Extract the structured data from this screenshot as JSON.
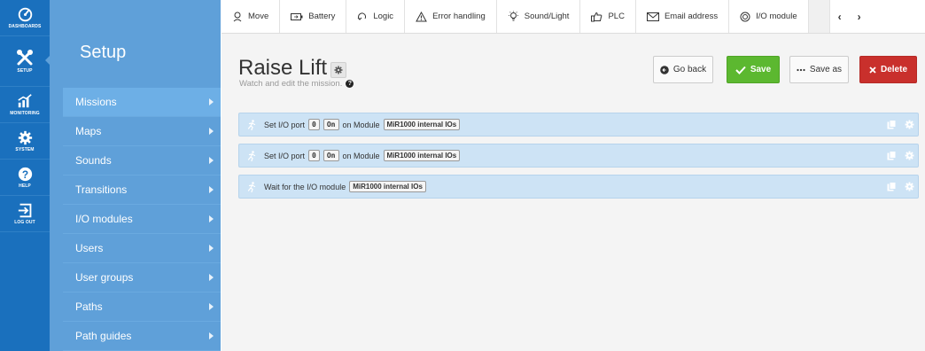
{
  "rail": [
    {
      "label": "DASHBOARDS",
      "icon": "dashboard-gauge-icon"
    },
    {
      "label": "SETUP",
      "icon": "tools-icon",
      "active": true
    },
    {
      "label": "MONITORING",
      "icon": "bar-chart-icon"
    },
    {
      "label": "SYSTEM",
      "icon": "gear-icon"
    },
    {
      "label": "HELP",
      "icon": "question-icon"
    },
    {
      "label": "LOG OUT",
      "icon": "logout-icon"
    }
  ],
  "panel": {
    "title": "Setup",
    "items": [
      {
        "label": "Missions",
        "active": true
      },
      {
        "label": "Maps"
      },
      {
        "label": "Sounds"
      },
      {
        "label": "Transitions"
      },
      {
        "label": "I/O modules"
      },
      {
        "label": "Users"
      },
      {
        "label": "User groups"
      },
      {
        "label": "Paths"
      },
      {
        "label": "Path guides"
      }
    ]
  },
  "toolbar": {
    "items": [
      {
        "label": "Move",
        "icon": "move-pin-icon"
      },
      {
        "label": "Battery",
        "icon": "battery-icon"
      },
      {
        "label": "Logic",
        "icon": "logic-arrow-icon"
      },
      {
        "label": "Error handling",
        "icon": "warning-icon"
      },
      {
        "label": "Sound/Light",
        "icon": "bulb-icon"
      },
      {
        "label": "PLC",
        "icon": "plc-hand-icon"
      },
      {
        "label": "Email address",
        "icon": "envelope-icon"
      },
      {
        "label": "I/O module",
        "icon": "io-module-icon"
      }
    ],
    "prev": "‹",
    "next": "›"
  },
  "mission": {
    "title": "Raise Lift",
    "subtitle": "Watch and edit the mission."
  },
  "buttons": {
    "go_back": "Go back",
    "save": "Save",
    "save_as": "Save as",
    "delete": "Delete"
  },
  "actions": [
    {
      "prefix": "Set I/O port",
      "port": "0",
      "state": "On",
      "middle": "on Module",
      "module": "MiR1000 internal IOs"
    },
    {
      "prefix": "Set I/O port",
      "port": "0",
      "state": "On",
      "middle": "on Module",
      "module": "MiR1000 internal IOs"
    },
    {
      "prefix": "Wait for the I/O module",
      "module": "MiR1000 internal IOs"
    }
  ],
  "colors": {
    "rail": "#1a70bd",
    "panel": "#5fa0d9",
    "save": "#5cb830",
    "delete": "#c9302c",
    "action_bg": "#cde3f5"
  }
}
